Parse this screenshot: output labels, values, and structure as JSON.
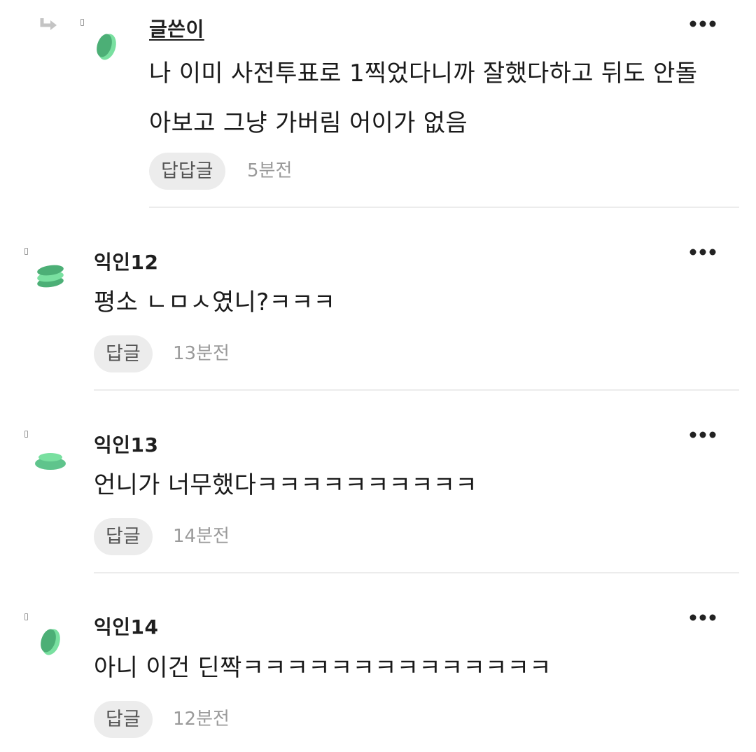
{
  "comments": [
    {
      "nickname": "글쓴이",
      "is_author": true,
      "is_reply": true,
      "body_lines": [
        "나 이미 사전투표로 1찍었다니까 잘했다하고 뒤도 안돌",
        "아보고 그냥 가버림 어이가 없음"
      ],
      "reply_label": "답답글",
      "time": "5분전",
      "avatar_icon": "leaf-avatar-icon"
    },
    {
      "nickname": "익인12",
      "is_author": false,
      "is_reply": false,
      "body_lines": [
        "평소 ㄴㅁㅅ였니?ㅋㅋㅋ"
      ],
      "reply_label": "답글",
      "time": "13분전",
      "avatar_icon": "stacked-discs-avatar-icon"
    },
    {
      "nickname": "익인13",
      "is_author": false,
      "is_reply": false,
      "body_lines": [
        "언니가 너무했다ㅋㅋㅋㅋㅋㅋㅋㅋㅋㅋ"
      ],
      "reply_label": "답글",
      "time": "14분전",
      "avatar_icon": "flat-disc-avatar-icon"
    },
    {
      "nickname": "익인14",
      "is_author": false,
      "is_reply": false,
      "body_lines": [
        "아니 이건 딘짝ㅋㅋㅋㅋㅋㅋㅋㅋㅋㅋㅋㅋㅋㅋ"
      ],
      "reply_label": "답글",
      "time": "12분전",
      "avatar_icon": "leaf-avatar-icon"
    }
  ],
  "colors": {
    "avatar_green_dark": "#4caf76",
    "avatar_green_light": "#79e0a0",
    "pill_bg": "#ececec",
    "divider": "#ececec",
    "time_text": "#9a9a9a"
  }
}
